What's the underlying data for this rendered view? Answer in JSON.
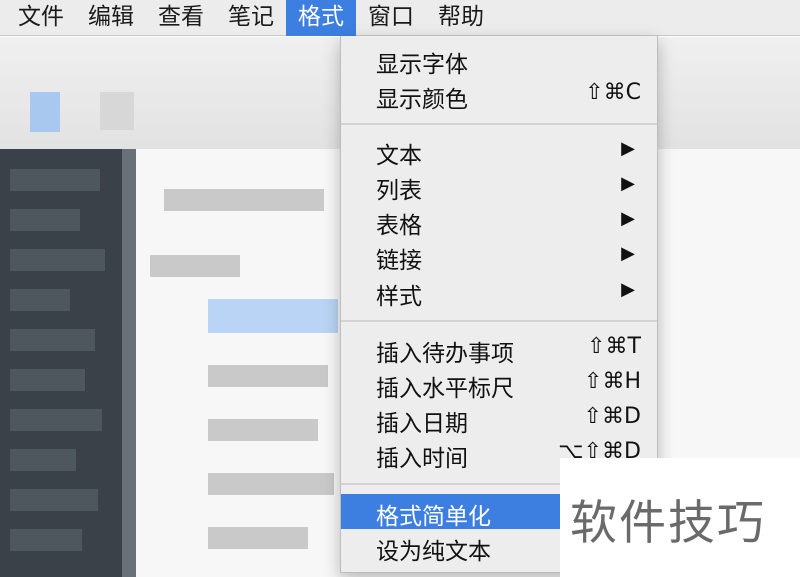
{
  "menubar": {
    "items": [
      "文件",
      "编辑",
      "查看",
      "笔记",
      "格式",
      "窗口",
      "帮助"
    ],
    "active_index": 4
  },
  "format_menu": {
    "groups": [
      [
        {
          "label": "显示字体",
          "shortcut": ""
        },
        {
          "label": "显示颜色",
          "shortcut": "⇧⌘C"
        }
      ],
      [
        {
          "label": "文本",
          "submenu": true
        },
        {
          "label": "列表",
          "submenu": true
        },
        {
          "label": "表格",
          "submenu": true
        },
        {
          "label": "链接",
          "submenu": true
        },
        {
          "label": "样式",
          "submenu": true
        }
      ],
      [
        {
          "label": "插入待办事项",
          "shortcut": "⇧⌘T"
        },
        {
          "label": "插入水平标尺",
          "shortcut": "⇧⌘H"
        },
        {
          "label": "插入日期",
          "shortcut": "⇧⌘D"
        },
        {
          "label": "插入时间",
          "shortcut": "⌥⇧⌘D"
        }
      ],
      [
        {
          "label": "格式简单化",
          "shortcut": "",
          "highlighted": true
        },
        {
          "label": "设为纯文本",
          "shortcut": ""
        }
      ]
    ],
    "submenu_arrow": "▶"
  },
  "watermark": {
    "text": "软件技巧"
  },
  "colors": {
    "highlight": "#3d7fe0",
    "menu_bg": "#ededed",
    "menubar_bg": "#ececec"
  }
}
